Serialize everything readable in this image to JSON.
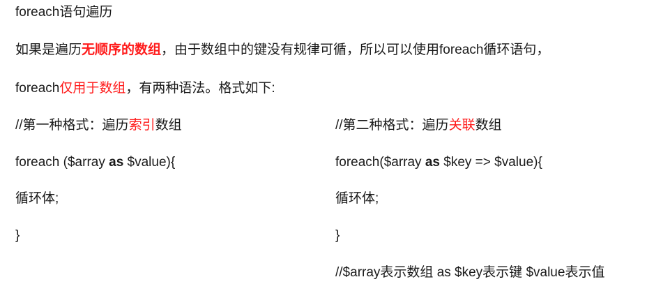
{
  "title": "foreach语句遍历",
  "para1": {
    "pre": "如果是遍历",
    "highlight": "无顺序的数组",
    "post": "，由于数组中的键没有规律可循，所以可以使用foreach循环语句，"
  },
  "para2": {
    "pre": "foreach",
    "highlight": "仅用于数组",
    "post": "，有两种语法。格式如下:"
  },
  "left": {
    "comment_pre": "//第一种格式：遍历",
    "comment_highlight": "索引",
    "comment_post": "数组",
    "code_pre": "foreach ($array ",
    "code_kw": "as",
    "code_post": " $value){",
    "body": "循环体;",
    "close": "}"
  },
  "right": {
    "comment_pre": "//第二种格式：遍历",
    "comment_highlight": "关联",
    "comment_post": "数组",
    "code_pre": "foreach($array ",
    "code_kw": "as",
    "code_post": " $key => $value){",
    "body": "循环体;",
    "close": "}",
    "note": "//$array表示数组 as $key表示键 $value表示值"
  },
  "colors": {
    "text": "#1a1a1a",
    "highlight": "#ff1a1a",
    "background": "#ffffff"
  }
}
